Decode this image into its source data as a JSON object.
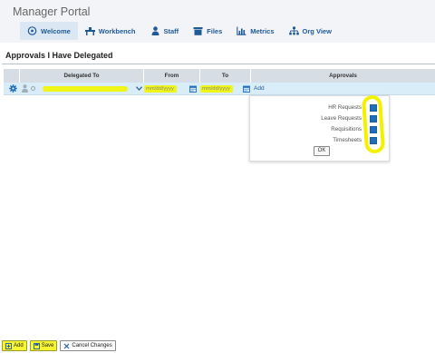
{
  "portal": {
    "title": "Manager Portal"
  },
  "nav": {
    "welcome": "Welcome",
    "workbench": "Workbench",
    "staff": "Staff",
    "files": "Files",
    "metrics": "Metrics",
    "org_view": "Org View"
  },
  "section": {
    "title": "Approvals I Have Delegated"
  },
  "table": {
    "headers": {
      "delegated_to": "Delegated To",
      "from": "From",
      "to": "To",
      "approvals": "Approvals"
    },
    "row": {
      "delegated_to_value": "",
      "from_placeholder": "mm/dd/yyyy",
      "to_placeholder": "mm/dd/yyyy",
      "add_link": "Add"
    }
  },
  "popup": {
    "options": [
      {
        "label": "HR Requests",
        "checked": true
      },
      {
        "label": "Leave Requests",
        "checked": true
      },
      {
        "label": "Requisitions",
        "checked": true
      },
      {
        "label": "Timesheets",
        "checked": true
      }
    ],
    "ok_label": "OK"
  },
  "footer": {
    "add_label": "Add",
    "save_label": "Save",
    "cancel_label": "Cancel Changes"
  },
  "colors": {
    "accent": "#1f5a98",
    "highlight": "#f0f518",
    "checkbox": "#1f6fb8",
    "header_bg": "#d6dde5",
    "row_bg": "#d9edf9"
  }
}
